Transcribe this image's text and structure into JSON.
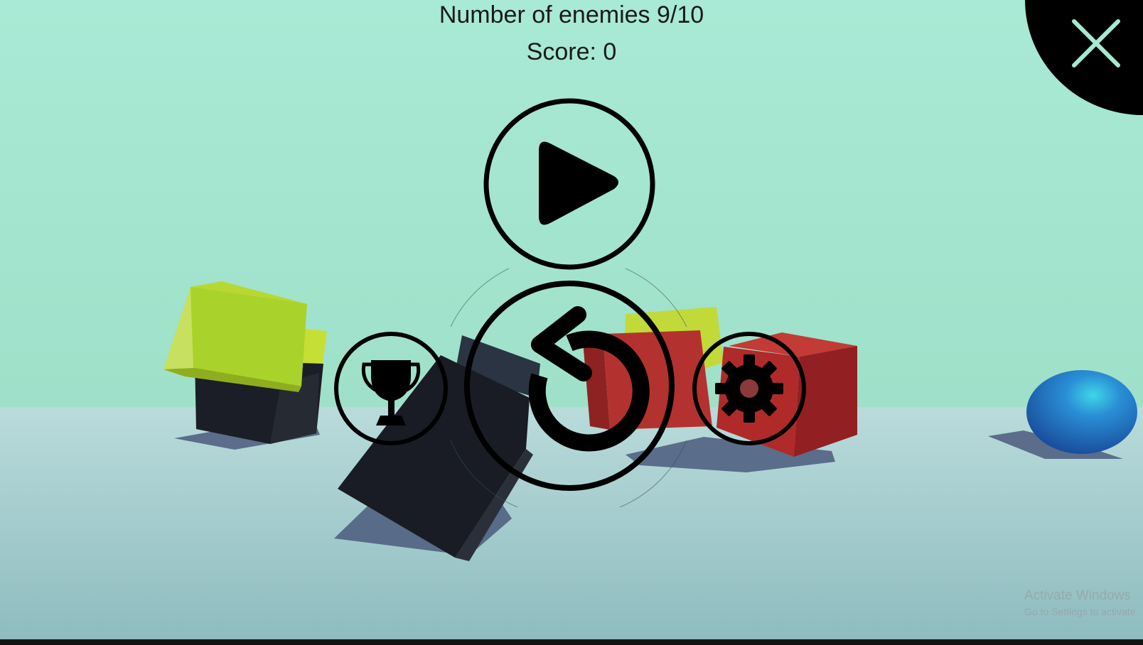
{
  "hud": {
    "enemies_label": "Number of enemies 9/10",
    "score_label": "Score: 0"
  },
  "menu": {
    "play_icon": "play-icon",
    "restart_icon": "restart-icon",
    "leaderboard_icon": "trophy-icon",
    "settings_icon": "gear-icon",
    "close_icon": "close-icon"
  },
  "watermark": {
    "title": "Activate Windows",
    "subtitle": "Go to Settings to activate"
  },
  "colors": {
    "sky": "#a6e8d2",
    "floor": "#9cc6c8",
    "icon": "#000000",
    "close_x": "#a6e8d2",
    "lime_cube": "#a9d22a",
    "red_cube": "#b02a2a",
    "dark_cube": "#1c1f27",
    "ball": "#1e6fc4"
  }
}
